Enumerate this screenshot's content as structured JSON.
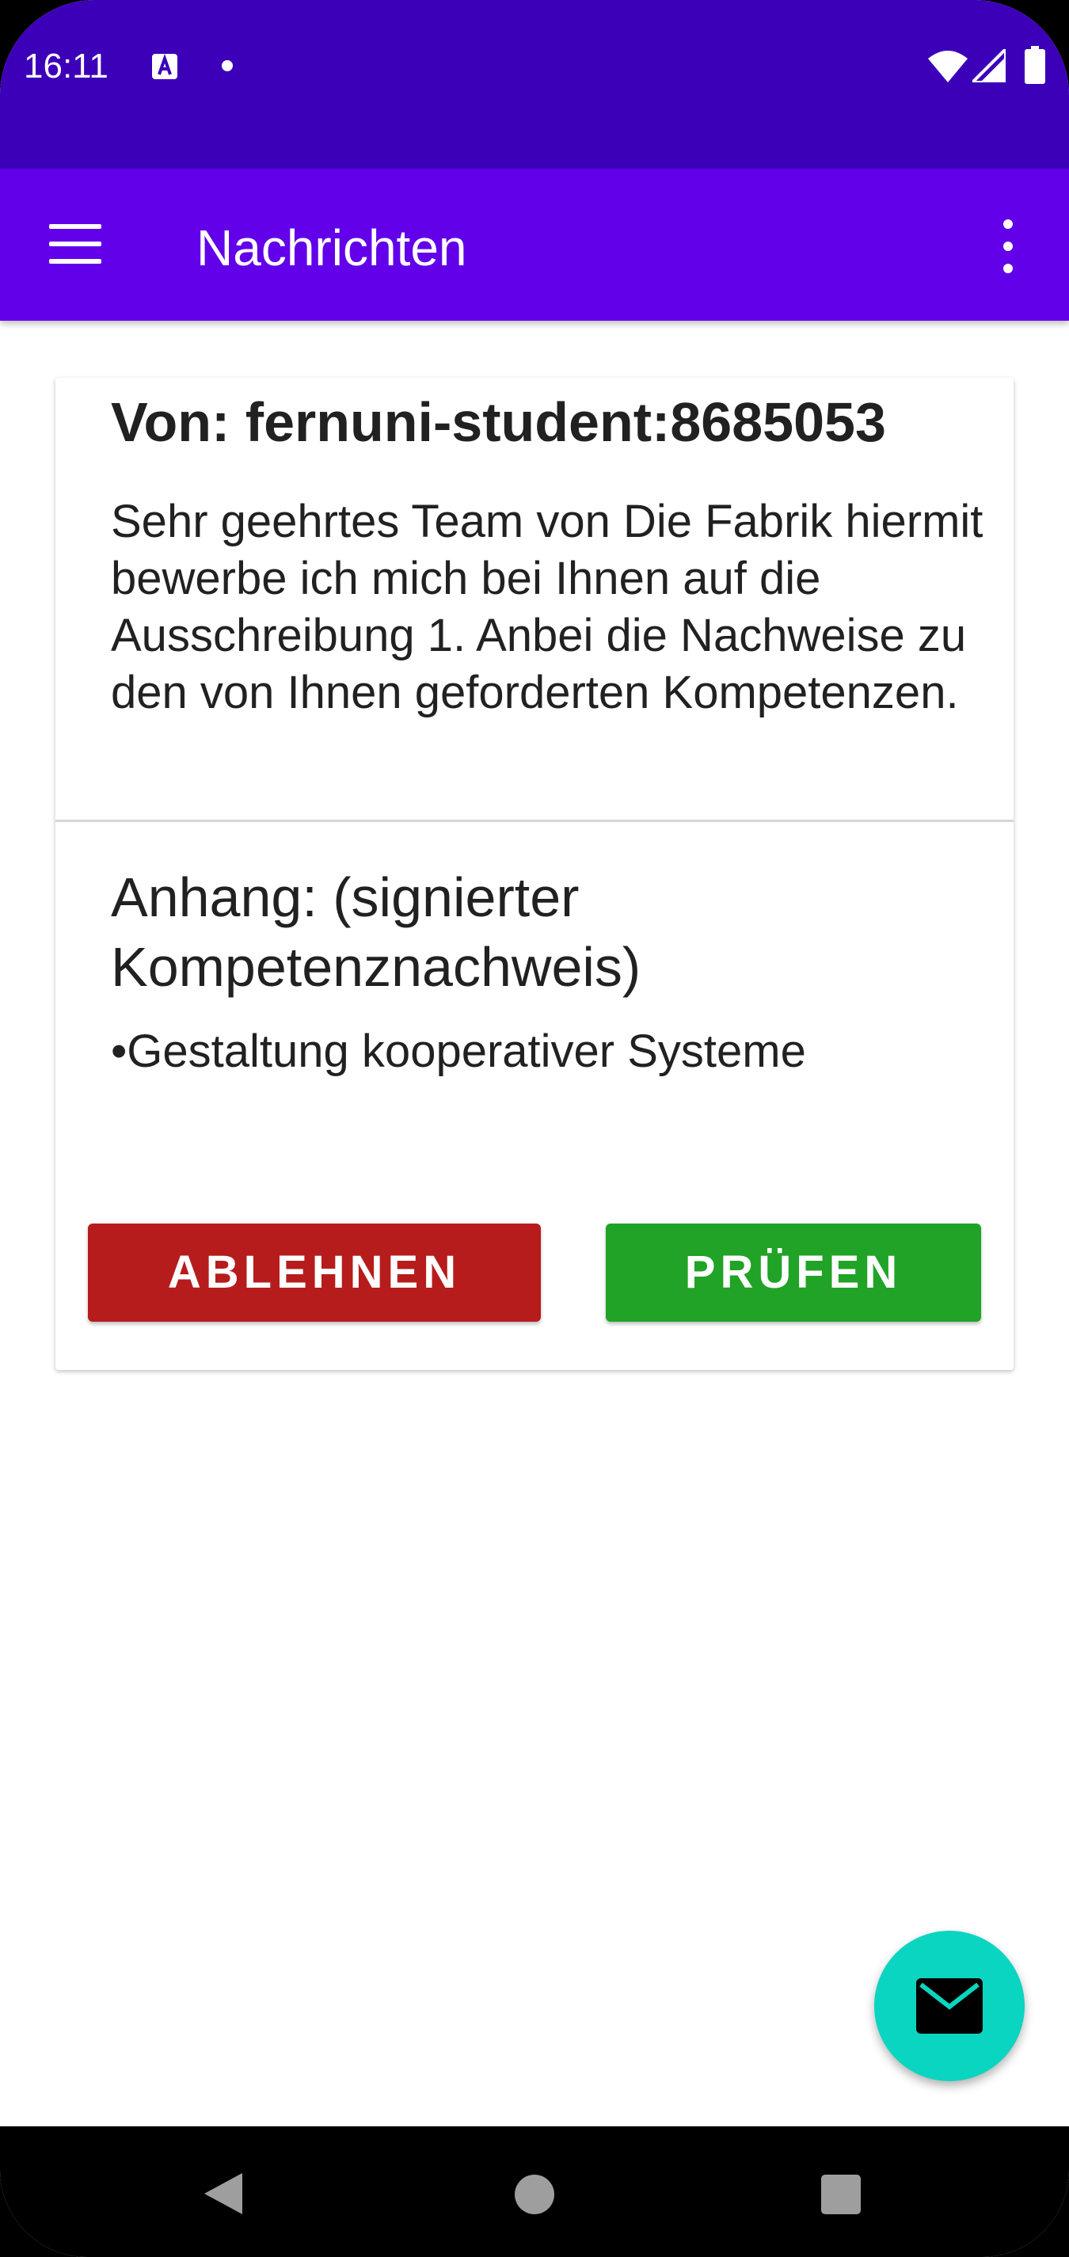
{
  "status_bar": {
    "time": "16:11",
    "icons": [
      "text-a-icon",
      "notification-dot-icon",
      "wifi-icon",
      "signal-icon",
      "battery-icon"
    ]
  },
  "app_bar": {
    "title": "Nachrichten",
    "menu_icon": "hamburger-menu-icon",
    "overflow_icon": "more-vert-icon",
    "background": "#6200ea"
  },
  "message": {
    "from": "Von: fernuni-student:8685053",
    "body": "Sehr geehrtes Team von Die Fabrik hiermit bewerbe ich mich bei Ihnen auf die Ausschreibung 1. Anbei die Nachweise zu den von Ihnen geforderten Kompetenzen.",
    "attachment_title": "Anhang: (signierter Kompetenznachweis)",
    "attachments": [
      "•Gestaltung kooperativer Systeme"
    ],
    "reject_label": "ABLEHNEN",
    "check_label": "PRÜFEN",
    "reject_color": "#b71c1c",
    "check_color": "#20a326"
  },
  "fab": {
    "icon": "mail-icon",
    "color": "#0ad5c0"
  },
  "nav_bar": {
    "icons": [
      "back-icon",
      "home-icon",
      "recents-icon"
    ]
  }
}
